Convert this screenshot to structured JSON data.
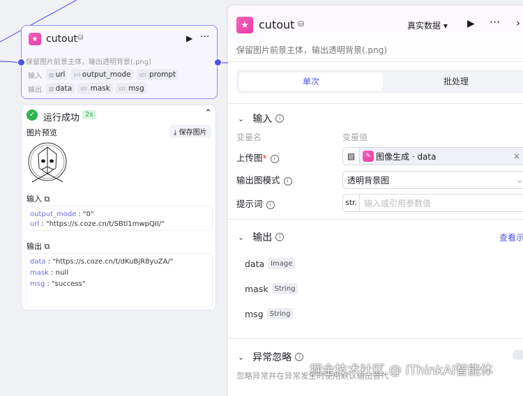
{
  "node": {
    "title": "cutout",
    "desc": "保留图片前景主体，输出透明背景(.png)",
    "input_label": "输入",
    "output_label": "输出",
    "inputs": [
      {
        "type": "img",
        "name": "url"
      },
      {
        "type": "int",
        "name": "output_mode"
      },
      {
        "type": "str.",
        "name": "prompt"
      }
    ],
    "outputs": [
      {
        "type": "img",
        "name": "data"
      },
      {
        "type": "str.",
        "name": "mask"
      },
      {
        "type": "str.",
        "name": "msg"
      }
    ]
  },
  "result": {
    "status": "运行成功",
    "time": "2s",
    "preview_label": "图片预览",
    "save_label": "保存图片",
    "input_label": "输入",
    "output_label": "输出",
    "input_lines": [
      {
        "k": "output_mode",
        "v": "\"0\""
      },
      {
        "k": "url",
        "v": "\"https://s.coze.cn/t/SBtl1mwpQII/\""
      }
    ],
    "output_lines": [
      {
        "k": "data",
        "v": "\"https://s.coze.cn/t/dKuBjR8yuZA/\""
      },
      {
        "k": "mask",
        "v": "null"
      },
      {
        "k": "msg",
        "v": "\"success\""
      }
    ]
  },
  "panel": {
    "title": "cutout",
    "data_mode": "真实数据",
    "desc": "保留图片前景主体，输出透明背景(.png)",
    "tabs": [
      "单次",
      "批处理"
    ],
    "input_section": "输入",
    "col_name": "变量名",
    "col_value": "变量值",
    "fields": [
      {
        "label": "上传图",
        "required": "*",
        "value": "图像生成 · data"
      },
      {
        "label": "输出图模式",
        "value": "透明背景图"
      },
      {
        "label": "提示词",
        "prefix": "str.",
        "placeholder": "输入或引用参数值"
      }
    ],
    "output_section": "输出",
    "view_link": "查看示",
    "outputs": [
      {
        "name": "data",
        "type": "Image"
      },
      {
        "name": "mask",
        "type": "String"
      },
      {
        "name": "msg",
        "type": "String"
      }
    ],
    "exception_section": "异常忽略",
    "exception_desc": "忽略异常并在异常发生时使用默认输出替代"
  },
  "watermark": "掘金技术社区 @ iThinkAi智能体"
}
